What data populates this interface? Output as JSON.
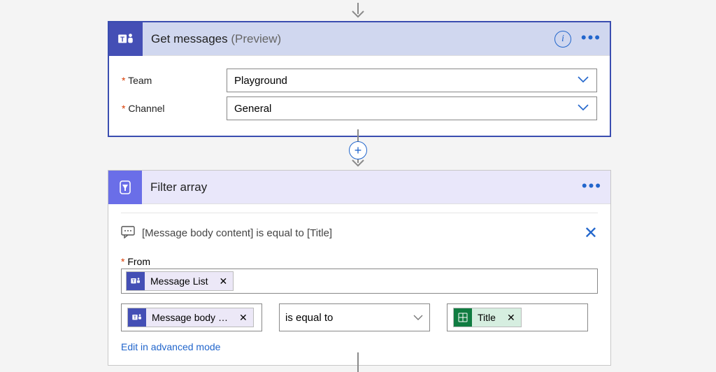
{
  "connector": {
    "vline_color": "#8a8a8a"
  },
  "card1": {
    "title": "Get messages",
    "suffix": "(Preview)",
    "icon": "teams-icon",
    "fields": {
      "team": {
        "label": "Team",
        "value": "Playground"
      },
      "channel": {
        "label": "Channel",
        "value": "General"
      }
    }
  },
  "card2": {
    "title": "Filter array",
    "icon": "filter-icon",
    "summary": "[Message body content] is equal to [Title]",
    "from": {
      "label": "From",
      "token": {
        "source": "teams",
        "text": "Message List"
      }
    },
    "condition": {
      "left": {
        "source": "teams",
        "text": "Message body …"
      },
      "operator": "is equal to",
      "right": {
        "source": "excel",
        "text": "Title"
      }
    },
    "advanced_link": "Edit in advanced mode"
  }
}
